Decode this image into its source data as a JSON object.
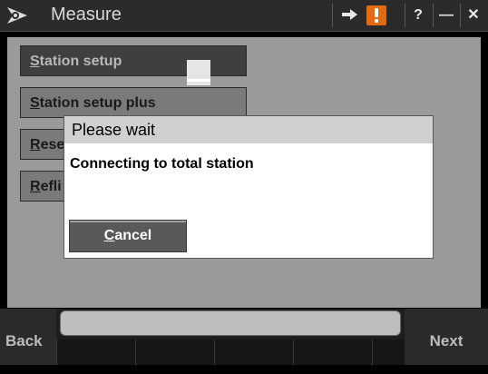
{
  "window": {
    "title": "Measure",
    "buttons": {
      "connection_icon": "arrow-in-icon",
      "alert_icon": "exclamation-icon",
      "help_label": "?",
      "minimize_label": "—",
      "close_label": "✕"
    },
    "accent_alert": "#e26a12"
  },
  "menu": {
    "items": [
      {
        "underline": "S",
        "rest": "tation setup"
      },
      {
        "underline": "S",
        "rest": "tation setup plus"
      },
      {
        "underline": "R",
        "rest": "ese"
      },
      {
        "underline": "R",
        "rest": "efli"
      }
    ]
  },
  "dialog": {
    "title": "Please wait",
    "message": "Connecting to total station",
    "cancel": {
      "underline": "C",
      "rest": "ancel"
    }
  },
  "footer": {
    "back_label": "Back",
    "next_label": "Next",
    "status_text": ""
  }
}
